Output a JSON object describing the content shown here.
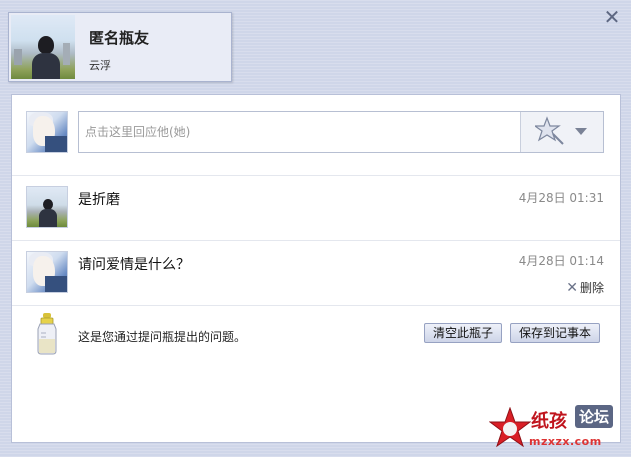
{
  "window": {
    "close_icon": "close-icon"
  },
  "profile": {
    "name": "匿名瓶友",
    "subtitle": "云浮"
  },
  "reply": {
    "placeholder": "点击这里回应他(她)",
    "emote_icon": "star-wand-icon"
  },
  "messages": [
    {
      "text": "是折磨",
      "time": "4月28日 01:31",
      "avatar": "city-avatar"
    },
    {
      "text": "请问爱情是什么？",
      "time": "4月28日 01:14",
      "avatar": "anime-avatar",
      "delete_label": "删除"
    }
  ],
  "footer": {
    "text": "这是您通过提问瓶提出的问题。",
    "clear_label": "清空此瓶子",
    "save_label": "保存到记事本"
  },
  "watermark": {
    "brand": "纸孩",
    "badge": "论坛",
    "url": "mzxzx.com"
  },
  "colors": {
    "frame": "#cfd6e9",
    "panel": "#ffffff",
    "button": "#cdd4e8",
    "watermark_red": "#c0141d"
  }
}
